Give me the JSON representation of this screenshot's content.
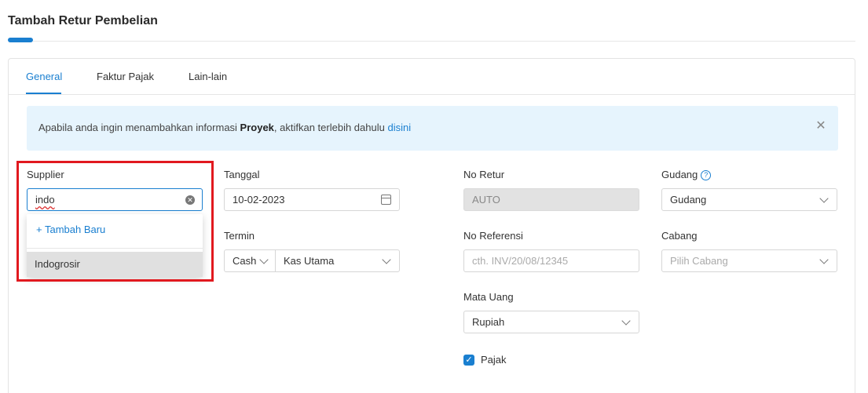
{
  "page": {
    "title": "Tambah Retur Pembelian"
  },
  "tabs": [
    {
      "label": "General",
      "active": true
    },
    {
      "label": "Faktur Pajak",
      "active": false
    },
    {
      "label": "Lain-lain",
      "active": false
    }
  ],
  "banner": {
    "text_before": "Apabila anda ingin menambahkan informasi ",
    "bold": "Proyek",
    "text_after": ", aktifkan terlebih dahulu ",
    "link": "disini",
    "close_icon": "close-icon"
  },
  "supplier": {
    "label": "Supplier",
    "value": "indo",
    "dropdown": {
      "add_new": "Tambah Baru",
      "options": [
        "Indogrosir"
      ]
    }
  },
  "tanggal": {
    "label": "Tanggal",
    "value": "10-02-2023"
  },
  "termin": {
    "label": "Termin",
    "value": "Cash",
    "account": "Kas Utama"
  },
  "no_retur": {
    "label": "No Retur",
    "value": "AUTO"
  },
  "no_referensi": {
    "label": "No Referensi",
    "placeholder": "cth. INV/20/08/12345"
  },
  "mata_uang": {
    "label": "Mata Uang",
    "value": "Rupiah"
  },
  "pajak": {
    "label": "Pajak",
    "checked": true
  },
  "gudang": {
    "label": "Gudang",
    "value": "Gudang",
    "help_icon": "help-icon"
  },
  "cabang": {
    "label": "Cabang",
    "placeholder": "Pilih Cabang"
  },
  "colors": {
    "accent": "#1a7fd0",
    "highlight": "#e1191f",
    "banner_bg": "#e6f4fd"
  }
}
